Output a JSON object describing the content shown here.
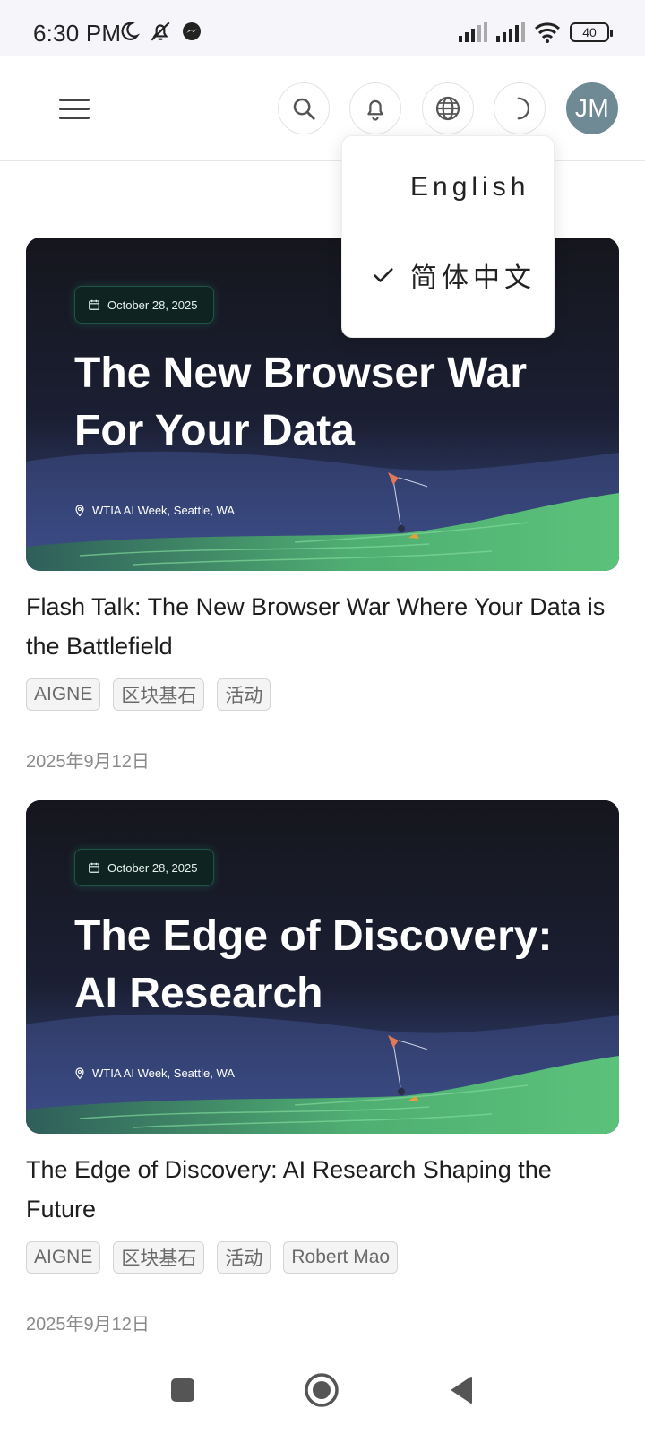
{
  "status_bar": {
    "time": "6:30 PM",
    "battery": "40",
    "icons_left": [
      "moon-icon",
      "bell-off-icon",
      "messenger-icon"
    ],
    "icons_right": [
      "signal-icon",
      "signal-icon",
      "wifi-icon",
      "battery-icon"
    ]
  },
  "header": {
    "avatar_initials": "JM",
    "buttons": [
      "menu-icon",
      "search-icon",
      "bell-icon",
      "globe-icon",
      "moon-icon"
    ]
  },
  "language_menu": {
    "options": [
      {
        "label": "English",
        "selected": false
      },
      {
        "label": "简体中文",
        "selected": true
      }
    ]
  },
  "events": [
    {
      "banner_date": "October 28, 2025",
      "banner_title": "The New Browser War For Your Data",
      "banner_location": "WTIA AI Week, Seattle, WA",
      "title": "Flash Talk: The New Browser War Where Your Data is the Battlefield",
      "tags": [
        "AIGNE",
        "区块基石",
        "活动"
      ],
      "date": "2025年9月12日"
    },
    {
      "banner_date": "October 28, 2025",
      "banner_title": "The Edge of Discovery: AI Research",
      "banner_location": "WTIA AI Week, Seattle, WA",
      "title": "The Edge of Discovery: AI Research Shaping the Future",
      "tags": [
        "AIGNE",
        "区块基石",
        "活动",
        "Robert Mao"
      ],
      "date": "2025年9月12日"
    }
  ],
  "colors": {
    "banner_bg": "#15161d",
    "green_hill": "#5bc27a",
    "avatar_bg": "#6f8a94"
  }
}
